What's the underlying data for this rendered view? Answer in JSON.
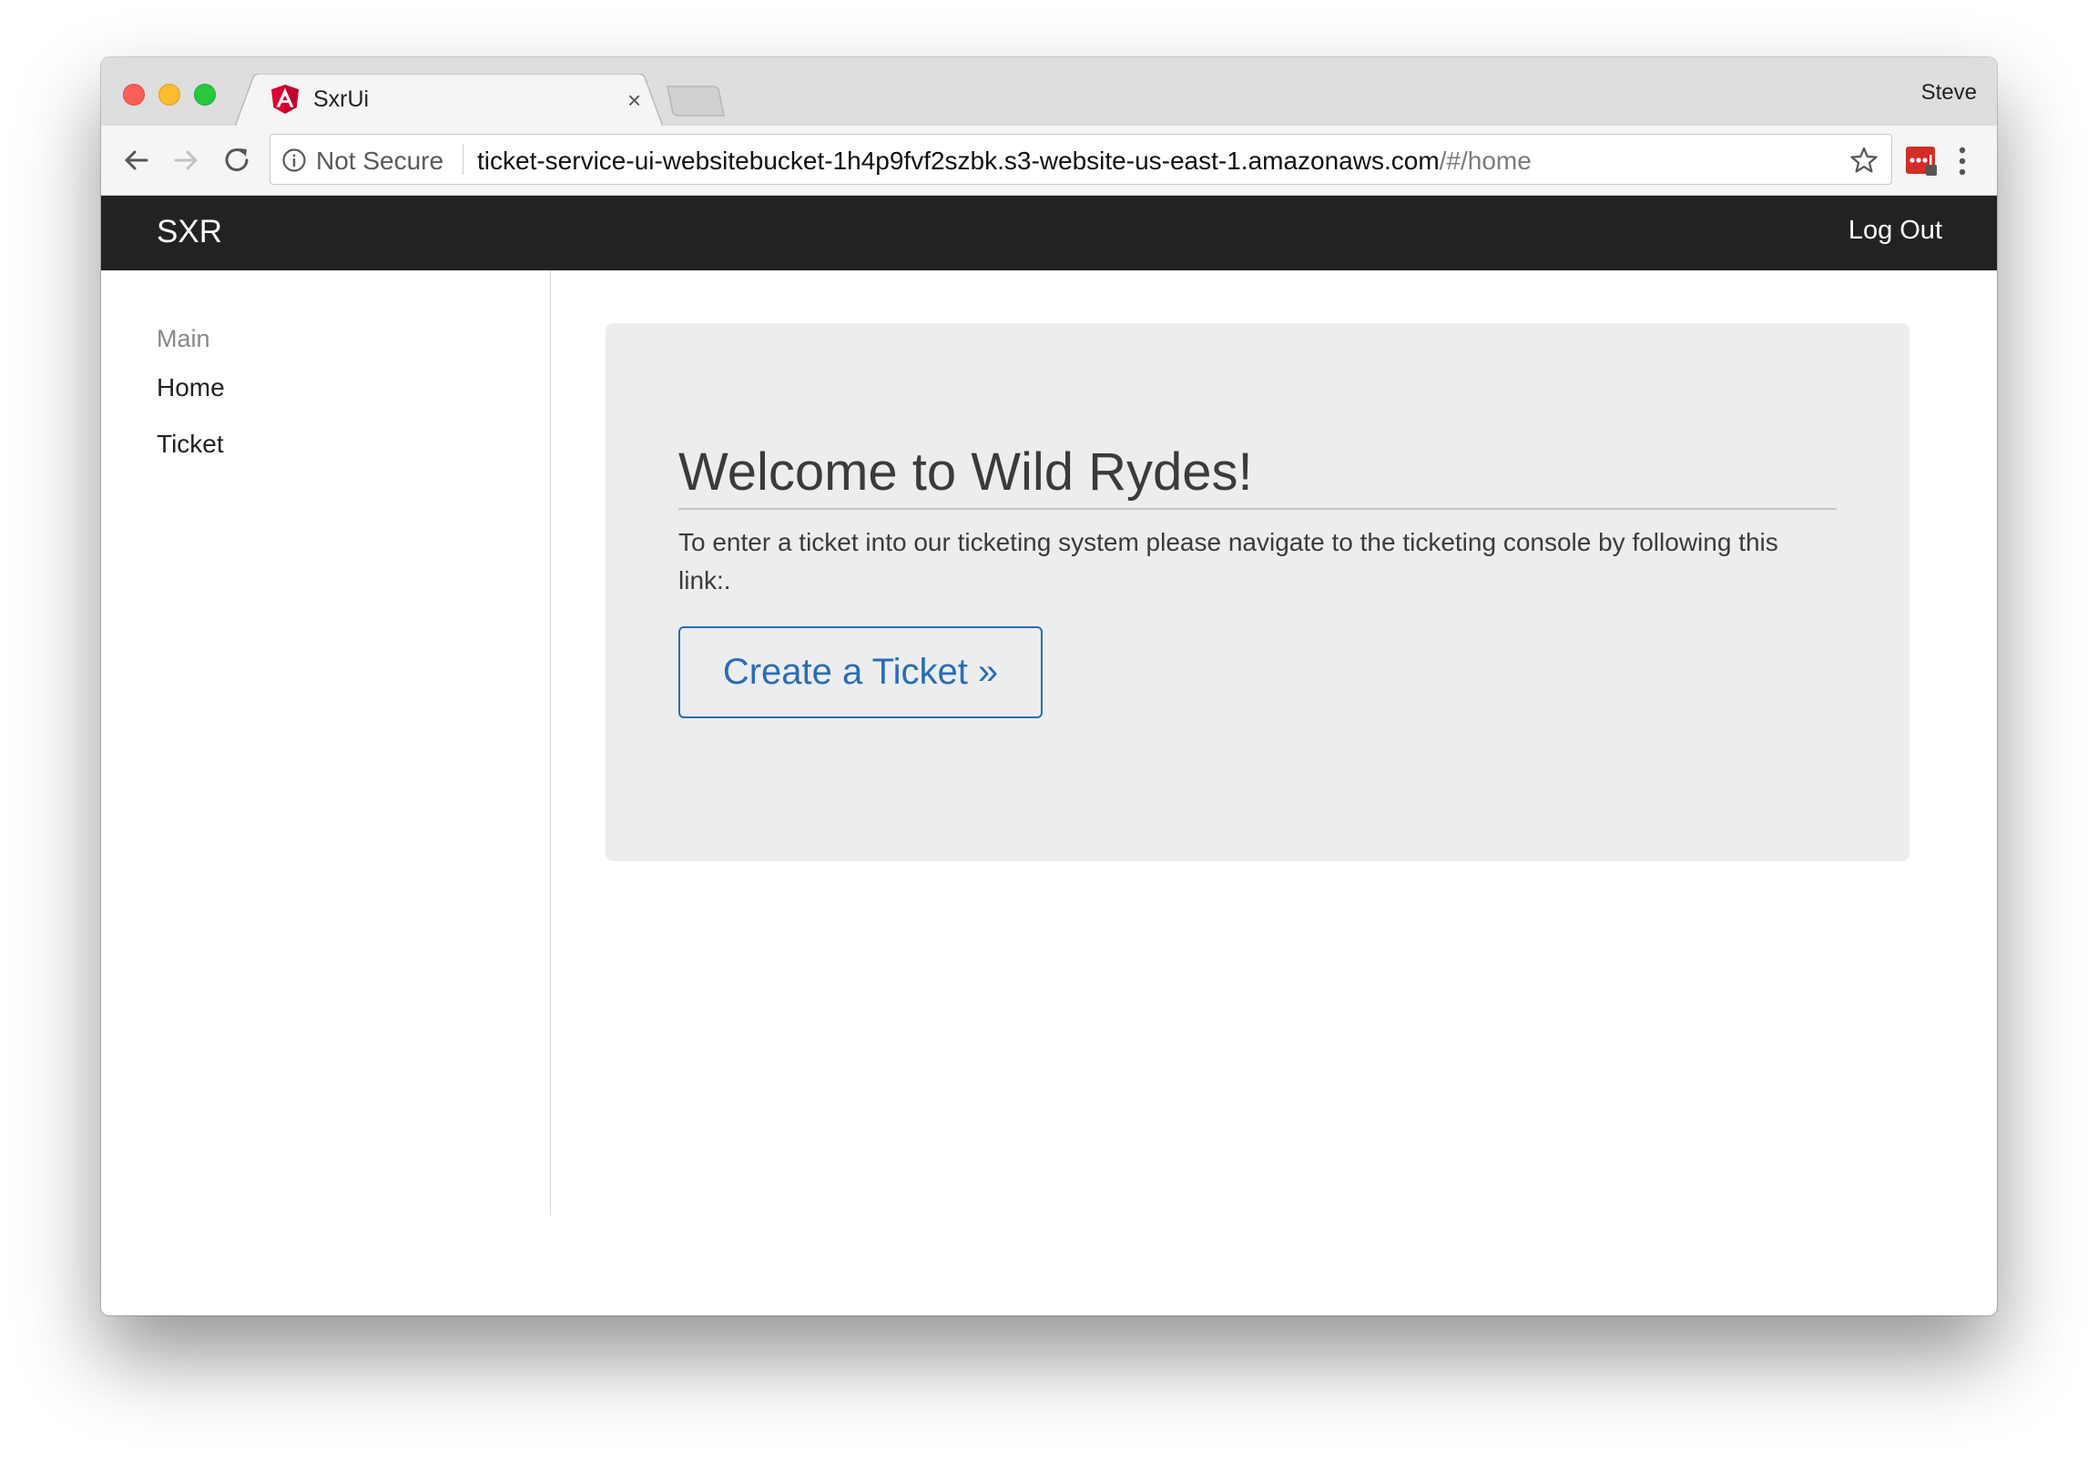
{
  "browser": {
    "tab_title": "SxrUi",
    "tab_close": "×",
    "profile_name": "Steve",
    "security_label": "Not Secure",
    "url_host": "ticket-service-ui-websitebucket-1h4p9fvf2szbk.s3-website-us-east-1.amazonaws.com",
    "url_path": "/#/home",
    "icons": {
      "back": "arrow-left-icon",
      "forward": "arrow-right-icon",
      "reload": "reload-icon",
      "info": "info-icon",
      "bookmark": "star-icon",
      "extension": "lastpass-icon",
      "menu": "kebab-menu-icon",
      "favicon": "angular-logo-icon"
    }
  },
  "navbar": {
    "brand": "SXR",
    "logout_label": "Log Out",
    "background": "#222222"
  },
  "sidebar": {
    "heading": "Main",
    "items": [
      {
        "label": "Home"
      },
      {
        "label": "Ticket"
      }
    ]
  },
  "main": {
    "title": "Welcome to Wild Rydes!",
    "body": "To enter a ticket into our ticketing system please navigate to the ticketing console by following this link:.",
    "button_label": "Create a Ticket »",
    "accent": "#2a6db5"
  }
}
